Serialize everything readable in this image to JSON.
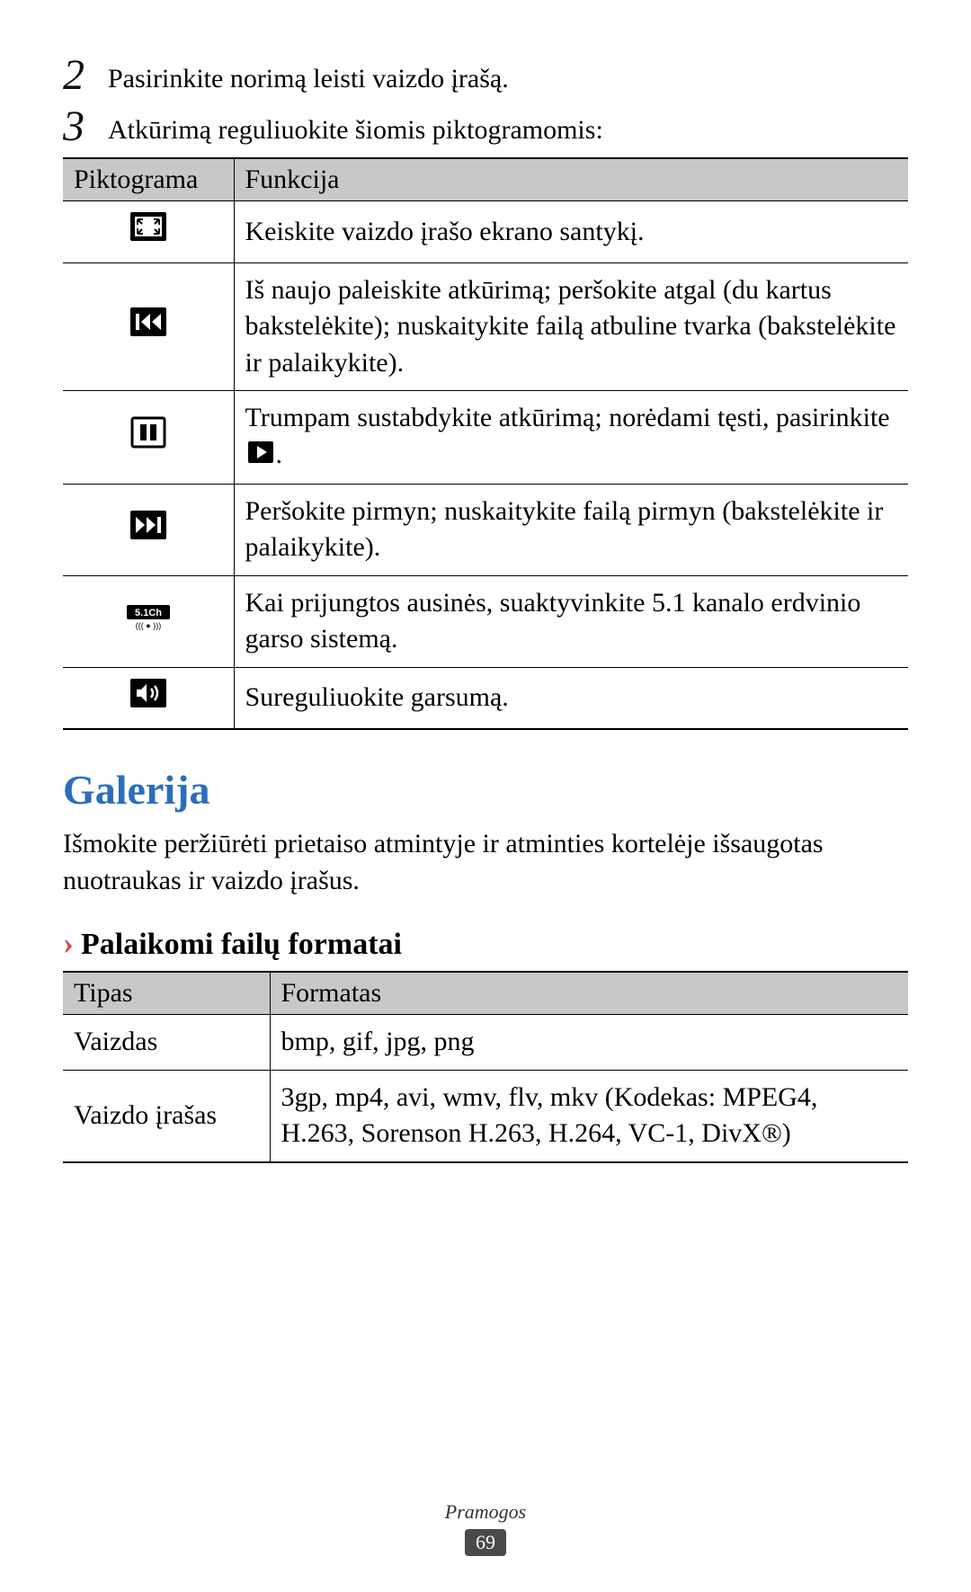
{
  "steps": {
    "s2": {
      "num": "2",
      "text": "Pasirinkite norimą leisti vaizdo įrašą."
    },
    "s3": {
      "num": "3",
      "text": "Atkūrimą reguliuokite šiomis piktogramomis:"
    }
  },
  "icon_table": {
    "headers": {
      "col1": "Piktograma",
      "col2": "Funkcija"
    },
    "rows": {
      "r0": "Keiskite vaizdo įrašo ekrano santykį.",
      "r1": "Iš naujo paleiskite atkūrimą; peršokite atgal (du kartus bakstelėkite); nuskaitykite failą atbuline tvarka (bakstelėkite ir palaikykite).",
      "r2a": "Trumpam sustabdykite atkūrimą; norėdami tęsti, pasirinkite ",
      "r2b": ".",
      "r3": "Peršokite pirmyn; nuskaitykite failą pirmyn (bakstelėkite ir palaikykite).",
      "r4": "Kai prijungtos ausinės, suaktyvinkite 5.1 kanalo erdvinio garso sistemą.",
      "r5": "Sureguliuokite garsumą."
    }
  },
  "section": {
    "title": "Galerija",
    "desc": "Išmokite peržiūrėti prietaiso atmintyje ir atminties kortelėje išsaugotas nuotraukas ir vaizdo įrašus."
  },
  "subsection": {
    "title": "Palaikomi failų formatai"
  },
  "format_table": {
    "headers": {
      "col1": "Tipas",
      "col2": "Formatas"
    },
    "rows": {
      "r0": {
        "c0": "Vaizdas",
        "c1": "bmp, gif, jpg, png"
      },
      "r1": {
        "c0": "Vaizdo įrašas",
        "c1": "3gp, mp4, avi, wmv, flv, mkv (Kodekas: MPEG4, H.263, Sorenson H.263, H.264, VC-1, DivX®)"
      }
    }
  },
  "footer": {
    "category": "Pramogos",
    "page": "69"
  }
}
